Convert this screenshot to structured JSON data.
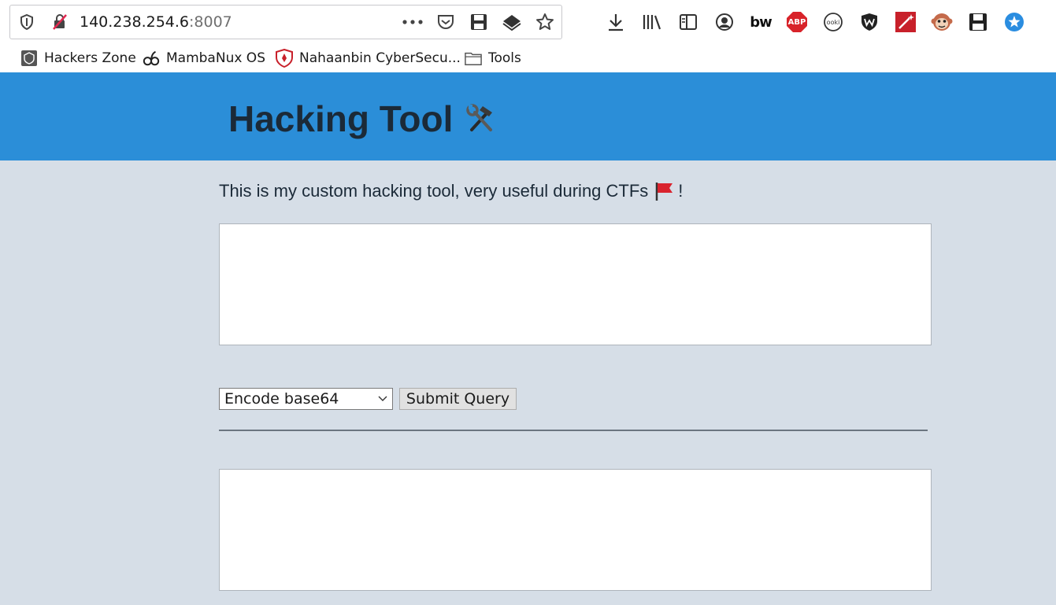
{
  "browser": {
    "url_host": "140.238.254.6",
    "url_port": ":8007",
    "bookmarks": [
      {
        "label": "Hackers Zone",
        "icon": "hackers-zone-icon"
      },
      {
        "label": "MambaNux OS",
        "icon": "mambanux-icon"
      },
      {
        "label": "Nahaanbin CyberSecu...",
        "icon": "nahaanbin-shield-icon"
      },
      {
        "label": "Tools",
        "icon": "folder-icon"
      }
    ],
    "toolbar_icons": [
      "download-icon",
      "library-icon",
      "sidebar-icon",
      "account-icon",
      "bw-icon",
      "adblock-icon",
      "ooki-icon",
      "w-shield-icon",
      "magic-wand-icon",
      "monkey-icon",
      "save-icon",
      "extension-star-icon"
    ],
    "bw_label": "bw",
    "abp_label": "ABP",
    "ooki_label": "ooki"
  },
  "page": {
    "title": "Hacking Tool",
    "intro_text": "This is my custom hacking tool, very useful during CTFs",
    "intro_suffix": "!",
    "input_value": "",
    "select_value": "Encode base64",
    "submit_label": "Submit Query",
    "output_value": ""
  },
  "colors": {
    "header_bg": "#2b8ed8",
    "page_bg": "#d6dee7",
    "flag": "#d9232e"
  }
}
